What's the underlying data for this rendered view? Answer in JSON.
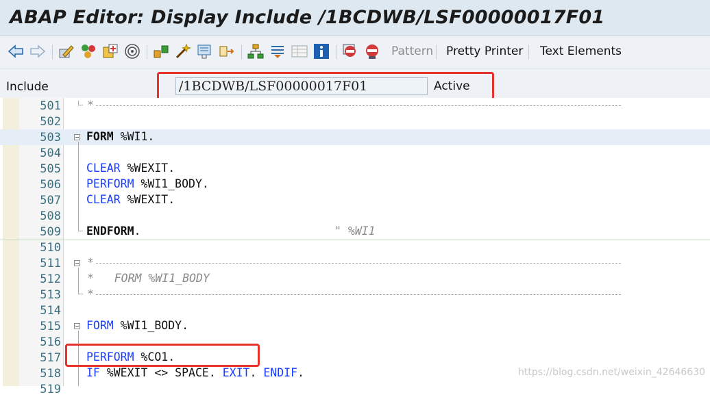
{
  "window": {
    "title": "ABAP Editor: Display Include /1BCDWB/LSF00000017F01"
  },
  "toolbar": {
    "icons": [
      "back-arrow-icon",
      "forward-arrow-icon",
      "edit-pencil-icon",
      "check-syntax-icon",
      "object-list-icon",
      "where-used-icon",
      "other-object-icon",
      "activate-icon",
      "test-run-icon",
      "display-object-icon",
      "enhancement-icon",
      "hierarchy-icon",
      "layout-icon",
      "table-icon",
      "info-icon",
      "breakpoint-session-icon",
      "breakpoint-external-icon"
    ],
    "pattern_label": "Pattern",
    "pretty_printer_label": "Pretty Printer",
    "text_elements_label": "Text Elements"
  },
  "include": {
    "label": "Include",
    "value": "/1BCDWB/LSF00000017F01",
    "status": "Active"
  },
  "editor": {
    "lines": [
      {
        "no": "501"
      },
      {
        "no": "502"
      },
      {
        "no": "503",
        "text": "FORM",
        "rest": " %WI1."
      },
      {
        "no": "504"
      },
      {
        "no": "505",
        "text": "CLEAR",
        "rest": " %WEXIT."
      },
      {
        "no": "506",
        "text": "PERFORM",
        "rest": " %WI1_BODY."
      },
      {
        "no": "507",
        "text": "CLEAR",
        "rest": " %WEXIT."
      },
      {
        "no": "508"
      },
      {
        "no": "509",
        "text": "ENDFORM",
        "rest": ".",
        "comment": "\" %WI1"
      },
      {
        "no": "510"
      },
      {
        "no": "511"
      },
      {
        "no": "512",
        "comment": "*   FORM %WI1_BODY"
      },
      {
        "no": "513"
      },
      {
        "no": "514"
      },
      {
        "no": "515",
        "text": "FORM",
        "rest": " %WI1_BODY."
      },
      {
        "no": "516"
      },
      {
        "no": "517",
        "text": "PERFORM",
        "rest": " %CO1."
      },
      {
        "no": "518",
        "text": "IF",
        "rest": " %WEXIT <> SPACE.",
        "text2": "EXIT",
        "rest2": ".",
        "text3": "ENDIF",
        "rest3": "."
      },
      {
        "no": "519"
      }
    ],
    "comment_prefix": "*"
  },
  "watermark": "https://blog.csdn.net/weixin_42646630",
  "colors": {
    "highlight_box": "#e8322d",
    "keyword": "#1a3cff",
    "line_number": "#3b6f7f"
  }
}
